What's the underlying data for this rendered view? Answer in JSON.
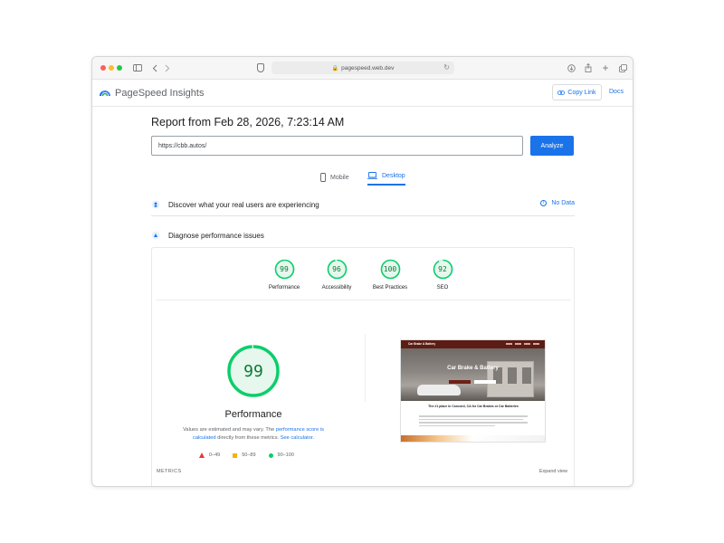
{
  "browser": {
    "url": "pagespeed.web.dev"
  },
  "header": {
    "title": "PageSpeed Insights",
    "copy_link": "Copy Link",
    "docs": "Docs"
  },
  "report": {
    "title": "Report from Feb 28, 2026, 7:23:14 AM",
    "url_value": "https://cbb.autos/",
    "analyze_label": "Analyze"
  },
  "tabs": {
    "mobile": "Mobile",
    "desktop": "Desktop",
    "active": "Desktop"
  },
  "sections": {
    "discover": "Discover what your real users are experiencing",
    "no_data": "No Data",
    "diagnose": "Diagnose performance issues"
  },
  "scores": [
    {
      "value": "99",
      "label": "Performance",
      "fraction": 0.99
    },
    {
      "value": "96",
      "label": "Accessibility",
      "fraction": 0.96
    },
    {
      "value": "100",
      "label": "Best Practices",
      "fraction": 1.0
    },
    {
      "value": "92",
      "label": "SEO",
      "fraction": 0.92
    }
  ],
  "performance": {
    "score": "99",
    "title": "Performance",
    "note_prefix": "Values are estimated and may vary. The ",
    "note_link1": "performance score is calculated",
    "note_mid": " directly from these metrics. ",
    "note_link2": "See calculator.",
    "legend": {
      "fail": "0–49",
      "average": "50–89",
      "pass": "90–100"
    }
  },
  "metrics": {
    "label": "METRICS",
    "expand": "Expand view"
  },
  "preview": {
    "brand": "Car Brake & Battery",
    "hero_title": "Car Brake & Battery",
    "body_title": "The #1 place in Concord, CA for Car Brakes or Car Batteries"
  },
  "colors": {
    "accent": "#1a73e8",
    "pass": "#0cce6b",
    "average": "#f4b400",
    "fail": "#e53935"
  }
}
